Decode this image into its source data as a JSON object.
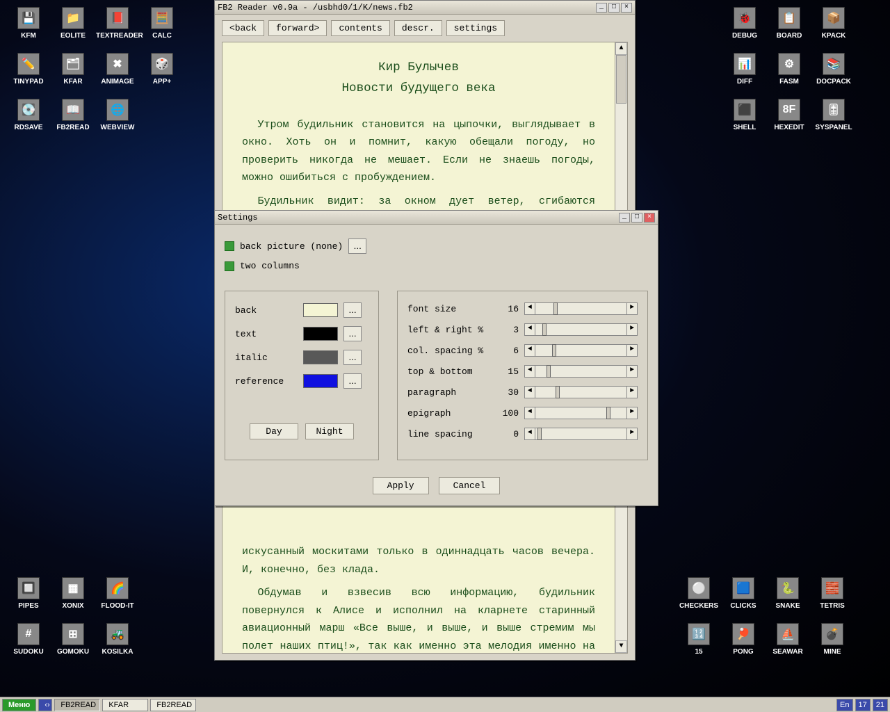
{
  "desktop_left": [
    {
      "label": "KFM",
      "emoji": "💾"
    },
    {
      "label": "EOLITE",
      "emoji": "📁"
    },
    {
      "label": "TEXTREADER",
      "emoji": "📕"
    },
    {
      "label": "CALC",
      "emoji": "🧮"
    },
    {
      "label": "TINYPAD",
      "emoji": "✏️"
    },
    {
      "label": "KFAR",
      "emoji": "🗂"
    },
    {
      "label": "ANIMAGE",
      "emoji": "✖"
    },
    {
      "label": "APP+",
      "emoji": "🎲"
    },
    {
      "label": "RDSAVE",
      "emoji": "💽"
    },
    {
      "label": "FB2READ",
      "emoji": "📖"
    },
    {
      "label": "WEBVIEW",
      "emoji": "🌐"
    }
  ],
  "desktop_right": [
    {
      "label": "DEBUG",
      "emoji": "🐞"
    },
    {
      "label": "BOARD",
      "emoji": "📋"
    },
    {
      "label": "KPACK",
      "emoji": "📦"
    },
    {
      "label": "DIFF",
      "emoji": "📊"
    },
    {
      "label": "FASM",
      "emoji": "⚙"
    },
    {
      "label": "DOCPACK",
      "emoji": "📚"
    },
    {
      "label": "SHELL",
      "emoji": "⬛"
    },
    {
      "label": "HEXEDIT",
      "emoji": "8F"
    },
    {
      "label": "SYSPANEL",
      "emoji": "🎚"
    }
  ],
  "games_left": [
    {
      "label": "PIPES",
      "emoji": "🔲"
    },
    {
      "label": "XONIX",
      "emoji": "▦"
    },
    {
      "label": "FLOOD-IT",
      "emoji": "🌈"
    },
    {
      "label": "SUDOKU",
      "emoji": "#"
    },
    {
      "label": "GOMOKU",
      "emoji": "⊞"
    },
    {
      "label": "KOSILKA",
      "emoji": "🚜"
    }
  ],
  "games_right": [
    {
      "label": "CHECKERS",
      "emoji": "⚪"
    },
    {
      "label": "CLICKS",
      "emoji": "🟦"
    },
    {
      "label": "SNAKE",
      "emoji": "🐍"
    },
    {
      "label": "TETRIS",
      "emoji": "🧱"
    },
    {
      "label": "15",
      "emoji": "🔢"
    },
    {
      "label": "PONG",
      "emoji": "🏓"
    },
    {
      "label": "SEAWAR",
      "emoji": "⛵"
    },
    {
      "label": "MINE",
      "emoji": "💣"
    }
  ],
  "reader": {
    "title": "FB2 Reader v0.9a - /usbhd0/1/K/news.fb2",
    "buttons": {
      "back": "<back",
      "forward": "forward>",
      "contents": "contents",
      "descr": "descr.",
      "settings": "settings"
    },
    "author": "Кир Булычев",
    "book": "Новости будущего века",
    "p1": "Утром будильник становится на цыпочки, выглядывает в окно. Хоть он и помнит, какую обещали погоду, но проверить никогда не мешает. Если не знаешь погоды, можно ошибиться с пробуждением.",
    "p2": "Будильник видит: за окном дует ветер, сгибаются березки, быстрые серые облака бегут по небу. Но дождя нет и не предвидится.",
    "p3": "искусанный москитами только в одиннадцать часов вечера. И, конечно, без клада.",
    "p4": "Обдумав и взвесив всю информацию, будильник повернулся к Алисе и исполнил на кларнете старинный авиационный марш «Все выше, и выше, и выше стремим мы полет наших птиц!», так как именно эта мелодия именно на кларнете лучше всего подходила для того, чтобы разбудить Алису."
  },
  "settings": {
    "title": "Settings",
    "back_picture": "back picture (none)",
    "dots": "...",
    "two_cols": "two columns",
    "colors": {
      "back": {
        "label": "back",
        "val": "#f4f4d4"
      },
      "text": {
        "label": "text",
        "val": "#000000"
      },
      "italic": {
        "label": "italic",
        "val": "#585858"
      },
      "reference": {
        "label": "reference",
        "val": "#1010e0"
      }
    },
    "day": "Day",
    "night": "Night",
    "sliders": [
      {
        "label": "font size",
        "val": "16",
        "pos": 20
      },
      {
        "label": "left & right %",
        "val": "3",
        "pos": 8
      },
      {
        "label": "col. spacing %",
        "val": "6",
        "pos": 18
      },
      {
        "label": "top & bottom",
        "val": "15",
        "pos": 12
      },
      {
        "label": "paragraph",
        "val": "30",
        "pos": 22
      },
      {
        "label": "epigraph",
        "val": "100",
        "pos": 78
      },
      {
        "label": "line spacing",
        "val": "0",
        "pos": 2
      }
    ],
    "apply": "Apply",
    "cancel": "Cancel"
  },
  "taskbar": {
    "menu": "Меню",
    "items": [
      "FB2READ",
      "KFAR",
      "FB2READ"
    ],
    "lang": "En",
    "time1": "17",
    "time2": "21"
  }
}
